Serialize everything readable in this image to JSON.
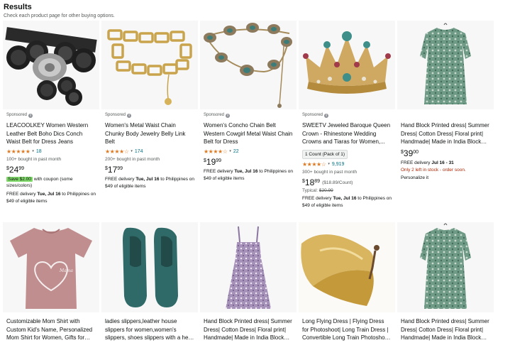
{
  "header": {
    "title": "Results",
    "subtitle": "Check each product page for other buying options."
  },
  "products": [
    {
      "sponsored": "Sponsored",
      "title": "LEACOOLKEY Women Western Leather Belt Boho Dics Conch Waist Belt for Dress Jeans",
      "stars": "★★★★★",
      "reviews": "18",
      "bought": "100+ bought in past month",
      "price_symbol": "$",
      "price_whole": "24",
      "price_fraction": "99",
      "coupon_badge": "Save $2.00",
      "coupon_text": "with coupon (some sizes/colors)",
      "delivery_prefix": "FREE delivery",
      "delivery_date": "Tue, Jul 16",
      "delivery_suffix": "to Philippines on $49 of eligible items",
      "image_icon": "black-conch-belt-image"
    },
    {
      "sponsored": "Sponsored",
      "title": "Women's Metal Waist Chain Chunky Body Jewelry Belly Link Belt",
      "stars": "★★★★☆",
      "reviews": "174",
      "bought": "200+ bought in past month",
      "price_symbol": "$",
      "price_whole": "17",
      "price_fraction": "99",
      "delivery_prefix": "FREE delivery",
      "delivery_date": "Tue, Jul 16",
      "delivery_suffix": "to Philippines on $49 of eligible items",
      "image_icon": "gold-chain-belt-image"
    },
    {
      "sponsored": "Sponsored",
      "title": "Women's Concho Chain Belt Western Cowgirl Metal Waist Chain Belt for Dress",
      "stars": "★★★★☆",
      "reviews": "22",
      "price_symbol": "$",
      "price_whole": "19",
      "price_fraction": "99",
      "delivery_prefix": "FREE delivery",
      "delivery_date": "Tue, Jul 16",
      "delivery_suffix": "to Philippines on $49 of eligible items",
      "image_icon": "concho-chain-belt-image"
    },
    {
      "sponsored": "Sponsored",
      "title": "SWEETV Jeweled Baroque Queen Crown - Rhinestone Wedding Crowns and Tiaras for Women,...",
      "variant": "1 Count (Pack of 1)",
      "stars": "★★★★☆",
      "reviews": "9,919",
      "bought": "300+ bought in past month",
      "price_symbol": "$",
      "price_whole": "18",
      "price_fraction": "89",
      "price_unit": "($18.89/Count)",
      "typical_label": "Typical:",
      "typical_price": "$20.99",
      "delivery_prefix": "FREE delivery",
      "delivery_date": "Tue, Jul 16",
      "delivery_suffix": "to Philippines on $49 of eligible items",
      "image_icon": "baroque-crown-image"
    },
    {
      "title": "Hand Block Printed dress| Summer Dress| Cotton Dress| Floral print| Handmade| Made in India Block Print Dress| Cotton...",
      "price_symbol": "$",
      "price_whole": "39",
      "price_fraction": "00",
      "delivery_prefix": "FREE delivery",
      "delivery_date": "Jul 16 - 31",
      "stock": "Only 2 left in stock - order soon.",
      "personalize": "Personalize it",
      "image_icon": "green-floral-dress-image"
    },
    {
      "title": "Customizable Mom Shirt with Custom Kid's Name, Personalized Mom Shirt for Women, Gifts for Mom Shirts, Mothers Day Gifts,...",
      "image_icon": "pink-mom-shirt-image"
    },
    {
      "title": "ladies slippers,leather house slippers for women,women's slippers, shoes slippers with a heel, blue slippers,house slipper...",
      "image_icon": "teal-slippers-image"
    },
    {
      "title": "Hand Block Printed dress| Summer Dress| Cotton Dress| Floral print| Handmade| Made in India Block Print Dress| Cotton...",
      "image_icon": "lilac-floral-dress-image"
    },
    {
      "title": "Long Flying Dress | Flying Dress for Photoshoot| Long Train Dress | Convertible Long Train Photoshoot Dress",
      "image_icon": "gold-flying-dress-image"
    },
    {
      "title": "Hand Block Printed dress| Summer Dress| Cotton Dress| Floral print| Handmade| Made in India Block Print Dress| Cotton...",
      "image_icon": "green-floral-dress-image"
    }
  ],
  "colors": {
    "star": "#de7921",
    "link": "#007185",
    "coupon": "#7fda69",
    "stock_warning": "#b12704",
    "image_bg": "#f7f7f7"
  }
}
